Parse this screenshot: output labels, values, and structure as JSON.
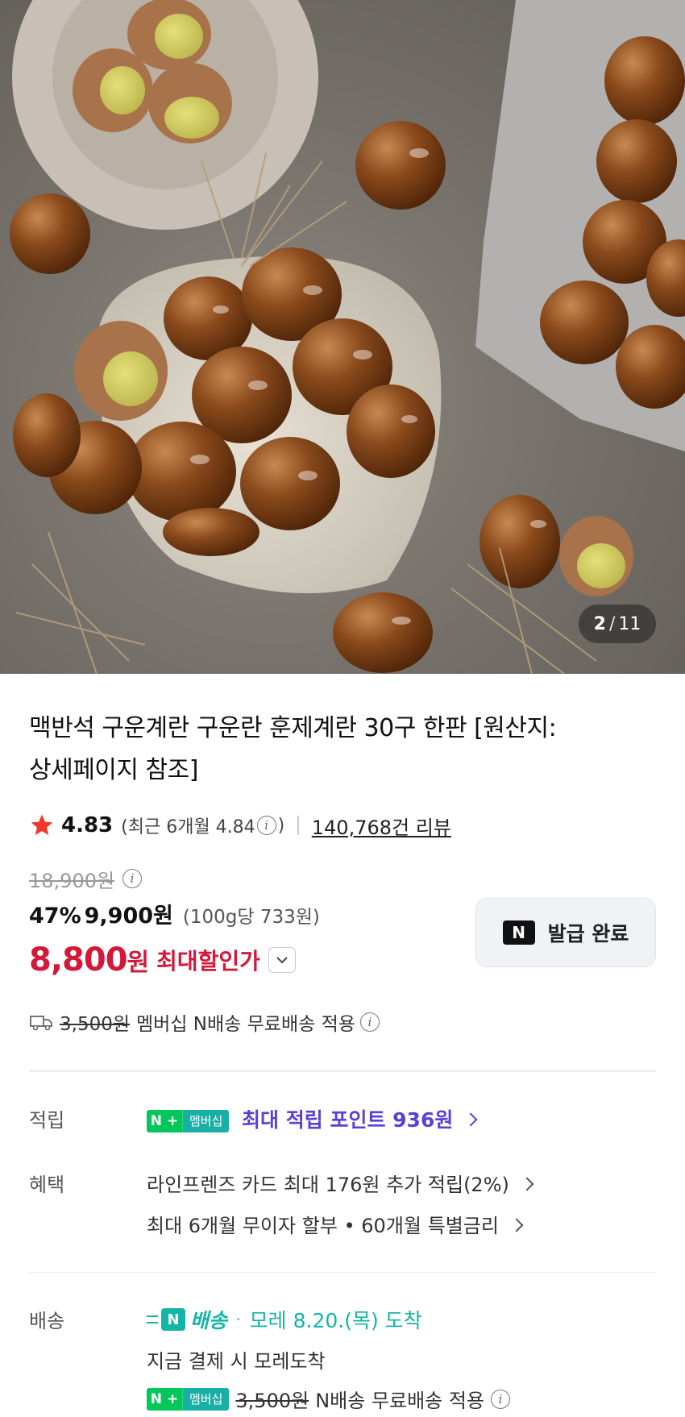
{
  "gallery": {
    "current": "2",
    "separator": "/",
    "total": "11"
  },
  "product": {
    "title_line1": "맥반석 구운계란 구운란 훈제계란 30구 한판 [원산지:",
    "title_line2": "상세페이지 참조]",
    "rating": "4.83",
    "recent_rating_prefix": "(최근 6개월 4.84",
    "recent_rating_suffix": ")",
    "review_count": "140,768건 리뷰"
  },
  "price": {
    "original": "18,900원",
    "discount_pct": "47%",
    "sale": "9,900원",
    "unit_price": "(100g당 733원)",
    "max_discount_value": "8,800",
    "max_discount_unit": "원",
    "max_discount_label": "최대할인가"
  },
  "coupon": {
    "badge": "N",
    "label": "발급 완료"
  },
  "shipping_summary": {
    "original_fee": "3,500원",
    "text": "멤버십 N배송 무료배송 적용"
  },
  "points": {
    "label": "적립",
    "badge_n": "N +",
    "badge_member": "멤버십",
    "text": "최대 적립 포인트 936원"
  },
  "benefits": {
    "label": "혜택",
    "line1": "라인프렌즈 카드 최대 176원 추가 적립(2%)",
    "line2": "최대 6개월 무이자 할부 • 60개월 특별금리"
  },
  "delivery": {
    "label": "배송",
    "brand_badge": "N",
    "brand_text": "배송",
    "dot": "·",
    "arrival": "모레 8.20.(목) 도착",
    "note": "지금 결제 시 모레도착",
    "badge_n": "N +",
    "badge_member": "멤버십",
    "original_fee": "3,500원",
    "fee_text": "N배송 무료배송 적용"
  },
  "colors": {
    "accent_red": "#d3193a",
    "point_purple": "#5b3fd6",
    "delivery_teal": "#13b5a6",
    "naver_green": "#03c75a"
  }
}
